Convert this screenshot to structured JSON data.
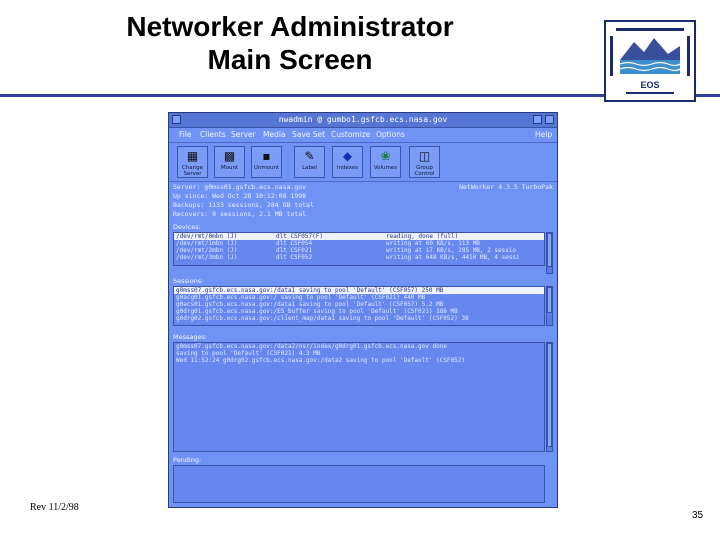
{
  "slide": {
    "title_line1": "Networker Administrator",
    "title_line2": "Main Screen",
    "logo_text": "EOS",
    "revision": "Rev 11/2/98",
    "page_number": "35"
  },
  "colors": {
    "window_bg": "#6f93f4",
    "title_rule": "#2e3f9e",
    "selection": "#eef2ff"
  },
  "window": {
    "title": "nwadmin @ gumbo1.gsfcb.ecs.nasa.gov",
    "menu": [
      "File",
      "Clients",
      "Server",
      "Media",
      "Save Set",
      "Customize",
      "Options"
    ],
    "help": "Help",
    "toolbar": [
      {
        "label": "Change Server",
        "icon": "change-server-icon"
      },
      {
        "label": "Mount",
        "icon": "mount-icon"
      },
      {
        "label": "Unmount",
        "icon": "unmount-icon"
      },
      {
        "label": "Label",
        "icon": "label-icon"
      },
      {
        "label": "Indexes",
        "icon": "indexes-icon"
      },
      {
        "label": "Volumes",
        "icon": "volumes-icon"
      },
      {
        "label": "Group Control",
        "icon": "group-control-icon"
      }
    ],
    "info": {
      "server": "Server: g0mss01.gsfcb.ecs.nasa.gov",
      "up_since": "Up since: Wed Oct 28 10:12:08 1998",
      "backups": "Backups: 1133 sessions, 284 GB total",
      "recovers": "Recovers: 0 sessions, 2.1 MB total",
      "version": "NetWorker 4.3.5 TurboPak"
    },
    "devices_label": "Devices:",
    "devices": [
      [
        "/dev/rmt/0mbn (J)",
        "dlt CSF057(F)",
        "reading, done (full)"
      ],
      [
        "/dev/rmt/1mbn (J)",
        "dlt CSF054",
        "writing at 60 KB/s, 113 MB"
      ],
      [
        "/dev/rmt/2mbn (J)",
        "dlt CSF021",
        "writing at 17 KB/s, 285 MB, 2 sessio"
      ],
      [
        "/dev/rmt/3mbn (J)",
        "dlt CSF052",
        "writing at 648 KB/s, 4410 MB, 4 sessi"
      ]
    ],
    "sessions_label": "Sessions:",
    "sessions": [
      "g0mss07.gsfcb.ecs.nasa.gov:/data1 saving to pool 'Default' (CSF057) 250 MB",
      "g0acg01.gsfcb.ecs.nasa.gov:/ saving to pool 'Default' (CSF021) 440 MB",
      "g0acs01.gsfcb.ecs.nasa.gov:/data1 saving to pool 'Default' (CSF057) 5.2 MB",
      "g0drg01.gsfcb.ecs.nasa.gov:/ES_buffer saving to pool 'Default' (CSF021) 186 MB",
      "g0drg02.gsfcb.ecs.nasa.gov:/client_map/data1 saving to pool 'Default' (CSF052) 38"
    ],
    "messages_label": "Messages:",
    "messages": [
      "g0mss07.gsfcb.ecs.nasa.gov:/data2/nsr/index/g0drg01.gsfcb.ecs.nasa.gov done",
      "saving to pool 'Default' (CSF021) 4.3 MB",
      "Wed 11:52:24 g0drg02.gsfcb.ecs.nasa.gov:/data2 saving to pool 'Default' (CSF052)"
    ],
    "pending_label": "Pending:"
  }
}
